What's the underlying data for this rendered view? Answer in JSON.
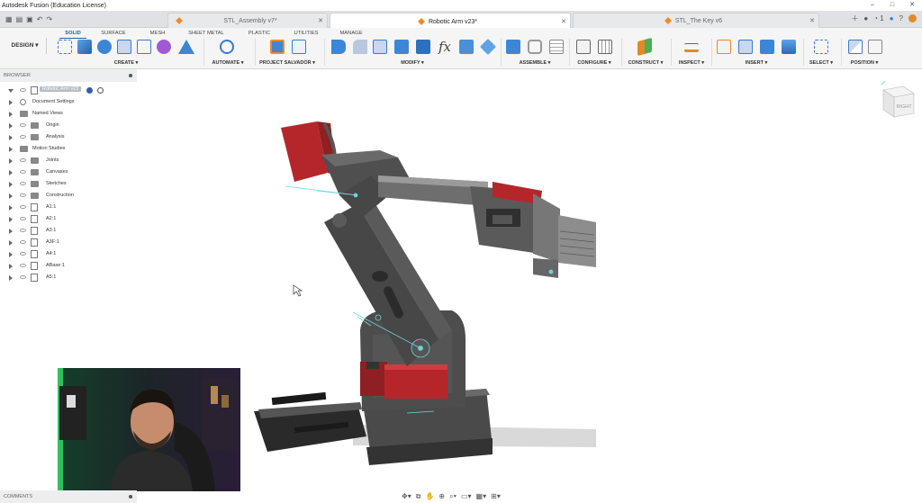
{
  "window": {
    "title": "Autodesk Fusion (Education License)",
    "controls": [
      "–",
      "□",
      "✕"
    ]
  },
  "tabs": [
    {
      "label": "STL_Assembly v7*",
      "active": false
    },
    {
      "label": "Robotic Arm v23*",
      "active": true
    },
    {
      "label": "STL_The Key v6",
      "active": false
    }
  ],
  "status_counts": {
    "jobs": "1"
  },
  "workspace": {
    "label": "DESIGN ▾"
  },
  "workspace_tabs": [
    "SOLID",
    "SURFACE",
    "MESH",
    "SHEET METAL",
    "PLASTIC",
    "UTILITIES",
    "MANAGE"
  ],
  "tool_groups": [
    "CREATE ▾",
    "AUTOMATE ▾",
    "PROJECT SALVADOR ▾",
    "MODIFY ▾",
    "ASSEMBLE ▾",
    "CONFIGURE ▾",
    "CONSTRUCT ▾",
    "INSPECT ▾",
    "INSERT ▾",
    "SELECT ▾",
    "POSITION ▾"
  ],
  "browser": {
    "title": "BROWSER",
    "root": "Robotic Arm v23",
    "items": [
      "Document Settings",
      "Named Views",
      "Origin",
      "Analysis",
      "Motion Studies",
      "Joints",
      "Canvases",
      "Sketches",
      "Construction",
      "A1:1",
      "A2:1",
      "A3:1",
      "A3F:1",
      "A4:1",
      "ABase:1",
      "A5:1"
    ]
  },
  "viewcube": {
    "face": "RIGHT"
  },
  "comments": {
    "title": "COMMENTS"
  },
  "colors": {
    "accent": "#1f5fa6",
    "body": "#4a4a4a",
    "servo": "#b5262a",
    "highlight": "#6fd3d8"
  }
}
